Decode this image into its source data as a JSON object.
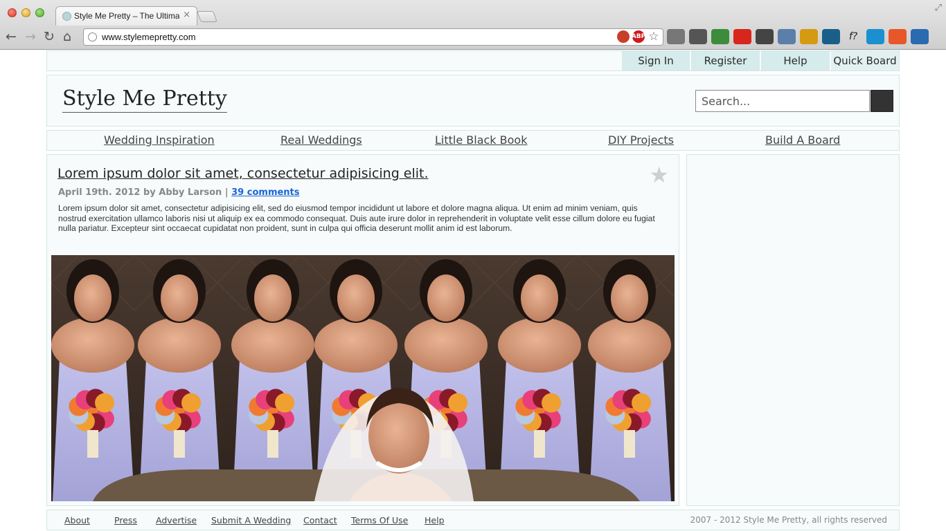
{
  "browser": {
    "tab_title": "Style Me Pretty – The Ultimate Wedding Blog",
    "tab_close": "×",
    "url": "www.stylemepretty.com",
    "icons": [
      "back-icon",
      "forward-icon",
      "reload-icon",
      "home-icon",
      "globe-icon",
      "bookmark-star-icon"
    ],
    "extension_colors": [
      "#777777",
      "#555555",
      "#3c8c3c",
      "#d9261c",
      "#444444",
      "#5b7fa8",
      "#d49a12",
      "#1a5f8a",
      "#222222",
      "#1c8fd0",
      "#e8562a",
      "#2a6ab0"
    ],
    "f_ext_label": "f?"
  },
  "topbar": {
    "sign_in": "Sign In",
    "register": "Register",
    "help": "Help",
    "quick_board": "Quick Board"
  },
  "header": {
    "logo": "Style Me Pretty",
    "search_placeholder": "Search..."
  },
  "nav": {
    "items": [
      "Wedding Inspiration",
      "Real Weddings",
      "Little Black Book",
      "DIY Projects",
      "Build A Board"
    ]
  },
  "post": {
    "title": "Lorem ipsum dolor sit amet, consectetur adipisicing elit.",
    "date_author": "April 19th. 2012 by Abby Larson",
    "separator": " | ",
    "comments": "39 comments",
    "body": "Lorem ipsum dolor sit amet, consectetur adipisicing elit, sed do eiusmod tempor incididunt ut labore et dolore magna aliqua. Ut enim ad minim veniam, quis nostrud exercitation ullamco laboris nisi ut aliquip ex ea commodo consequat. Duis aute irure dolor in reprehenderit in voluptate velit esse cillum dolore eu fugiat nulla pariatur. Excepteur sint occaecat cupidatat non proident, sunt in culpa qui officia deserunt mollit anim id est laborum.",
    "star_glyph": "★"
  },
  "colors": {
    "panel_bg": "#f7fbfb",
    "panel_border": "#d3e5e6",
    "topbar_button": "#d6ebeb",
    "dress": "#b4b3e2",
    "link_blue": "#1a66d6"
  },
  "footer": {
    "links": [
      "About",
      "Press",
      "Advertise",
      "Submit A Wedding",
      "Contact",
      "Terms Of Use",
      "Help"
    ],
    "copyright": "2007 - 2012 Style Me Pretty, all rights reserved"
  }
}
